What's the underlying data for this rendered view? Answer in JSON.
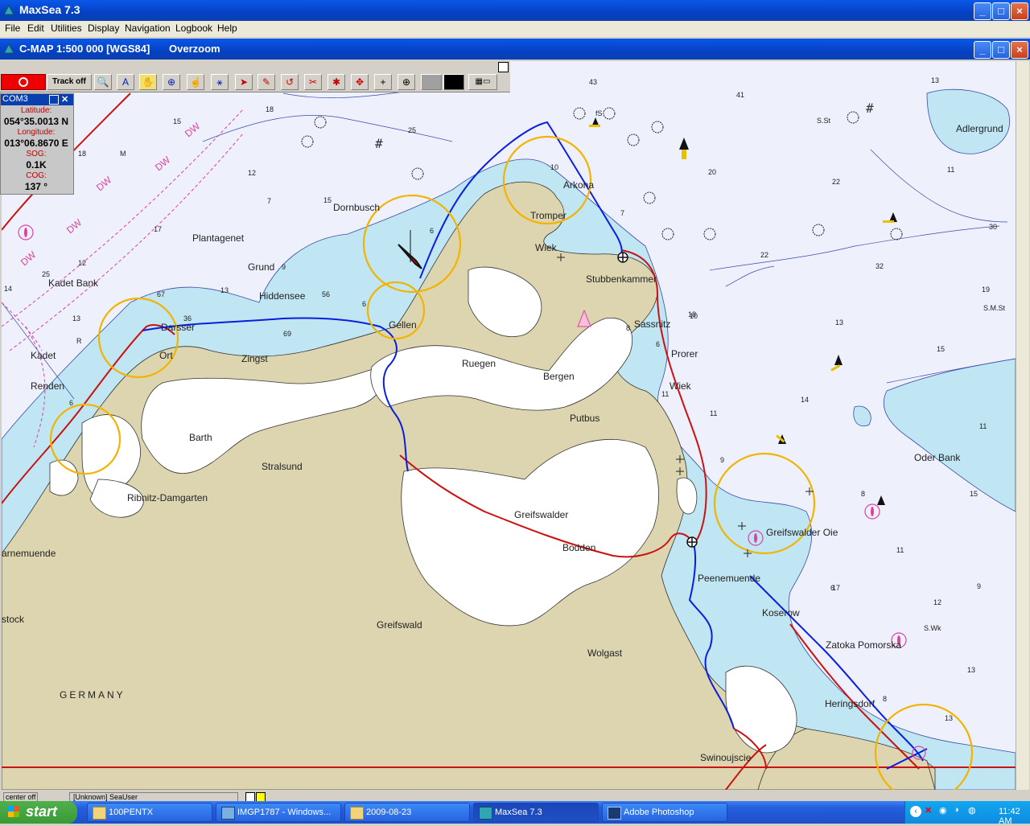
{
  "app": {
    "title": "MaxSea 7.3"
  },
  "menu": [
    "File",
    "Edit",
    "Utilities",
    "Display",
    "Navigation",
    "Logbook",
    "Help"
  ],
  "chart_window": {
    "title": "C-MAP  1:500 000 [WGS84]",
    "mode": "Overzoom"
  },
  "toolbar": {
    "track_label": "Track off"
  },
  "gps_panel": {
    "port": "COM3",
    "lat_label": "Latitude:",
    "lat": "054°35.0013 N",
    "lon_label": "Longitude:",
    "lon": "013°06.8670 E",
    "sog_label": "SOG:",
    "sog": "0.1K",
    "cog_label": "COG:",
    "cog": "137 °"
  },
  "places": [
    "Dornbusch",
    "Plantagenet",
    "Grund",
    "Hiddensee",
    "Kadet Bank",
    "Kadet",
    "Renden",
    "Darsser",
    "Ort",
    "Zingst",
    "Barth",
    "Stralsund",
    "Ribnitz-Damgarten",
    "arnemuende",
    "stock",
    "GERMANY",
    "Gellen",
    "Ruegen",
    "Bergen",
    "Putbus",
    "Arkona",
    "Tromper",
    "Wiek",
    "Stubbenkammer",
    "Sassnitz",
    "Prorer",
    "Wiek",
    "Greifswalder",
    "Bodden",
    "Greifswald",
    "Wolgast",
    "Peenemuende",
    "Koserow",
    "Zatoka Pomorska",
    "Heringsdorf",
    "Swinoujscie",
    "Greifswalder Oie",
    "Oder Bank",
    "Adlergrund"
  ],
  "depths": [
    "43",
    "41",
    "13",
    "18",
    "25",
    "15",
    "15",
    "18",
    "12",
    "17",
    "13",
    "12",
    "7",
    "9",
    "14",
    "13",
    "6",
    "36",
    "6",
    "69",
    "56",
    "67",
    "25",
    "10",
    "6",
    "8",
    "7",
    "20",
    "22",
    "30",
    "22",
    "32",
    "19",
    "18",
    "13",
    "15",
    "14",
    "11",
    "11",
    "11",
    "9",
    "8",
    "15",
    "9",
    "6",
    "11",
    "12",
    "13",
    "13",
    "11",
    "8",
    "10",
    "6",
    "11",
    "17",
    "14",
    "7",
    "11",
    "M",
    "R",
    "S.St",
    "S.M.St",
    "S.Wk",
    "fS",
    "S.M",
    "Wk"
  ],
  "status_bar": {
    "left": "center off",
    "user": "[Unknown] SeaUser"
  },
  "taskbar": {
    "start": "start",
    "tasks": [
      "100PENTX",
      "IMGP1787 - Windows...",
      "2009-08-23",
      "MaxSea 7.3",
      "Adobe Photoshop"
    ],
    "clock": "11:42 AM"
  },
  "colors": {
    "land": "#dcd5b0",
    "shallow": "#bfe6f2",
    "sea": "#eef1fb",
    "track_red": "#cc1111",
    "track_blue": "#0a1ee0",
    "circles": "#f2b400"
  }
}
